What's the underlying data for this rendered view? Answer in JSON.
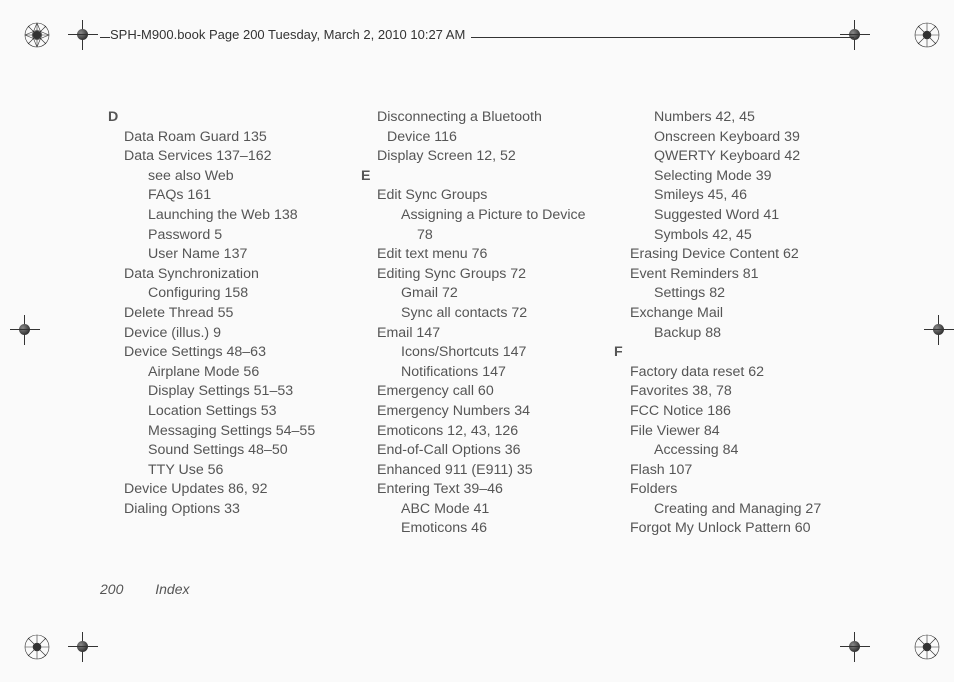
{
  "header": "SPH-M900.book  Page 200  Tuesday, March 2, 2010  10:27 AM",
  "footer": {
    "page": "200",
    "label": "Index"
  },
  "columns": [
    [
      {
        "cls": "letter",
        "t": "D"
      },
      {
        "cls": "l1",
        "t": "Data Roam Guard 135"
      },
      {
        "cls": "l1",
        "t": "Data Services 137–162"
      },
      {
        "cls": "l2",
        "t": "see also Web"
      },
      {
        "cls": "l2",
        "t": "FAQs 161"
      },
      {
        "cls": "l2",
        "t": "Launching the Web 138"
      },
      {
        "cls": "l2",
        "t": "Password 5"
      },
      {
        "cls": "l2",
        "t": "User Name 137"
      },
      {
        "cls": "l1",
        "t": "Data Synchronization"
      },
      {
        "cls": "l2",
        "t": "Configuring 158"
      },
      {
        "cls": "l1",
        "t": "Delete Thread 55"
      },
      {
        "cls": "l1",
        "t": "Device (illus.) 9"
      },
      {
        "cls": "l1",
        "t": "Device Settings 48–63"
      },
      {
        "cls": "l2",
        "t": "Airplane Mode 56"
      },
      {
        "cls": "l2",
        "t": "Display Settings 51–53"
      },
      {
        "cls": "l2",
        "t": "Location Settings 53"
      },
      {
        "cls": "l2",
        "t": "Messaging Settings 54–55"
      },
      {
        "cls": "l2",
        "t": "Sound Settings 48–50"
      },
      {
        "cls": "l2",
        "t": "TTY Use 56"
      },
      {
        "cls": "l1",
        "t": "Device Updates 86, 92"
      },
      {
        "cls": "l1",
        "t": "Dialing Options 33"
      }
    ],
    [
      {
        "cls": "hang",
        "t": "Disconnecting a Bluetooth"
      },
      {
        "cls": "hang-cont",
        "t": "Device 116"
      },
      {
        "cls": "l1",
        "t": "Display Screen 12, 52"
      },
      {
        "cls": "letter",
        "t": "E"
      },
      {
        "cls": "l1",
        "t": "Edit Sync Groups"
      },
      {
        "cls": "l2",
        "t": "Assigning a Picture to Device"
      },
      {
        "cls": "l3",
        "t": "78"
      },
      {
        "cls": "l1",
        "t": "Edit text menu 76"
      },
      {
        "cls": "l1",
        "t": "Editing Sync Groups 72"
      },
      {
        "cls": "l2",
        "t": "Gmail 72"
      },
      {
        "cls": "l2",
        "t": "Sync all contacts 72"
      },
      {
        "cls": "l1",
        "t": "Email 147"
      },
      {
        "cls": "l2",
        "t": "Icons/Shortcuts 147"
      },
      {
        "cls": "l2",
        "t": "Notifications 147"
      },
      {
        "cls": "l1",
        "t": "Emergency call 60"
      },
      {
        "cls": "l1",
        "t": "Emergency Numbers 34"
      },
      {
        "cls": "l1",
        "t": "Emoticons 12, 43, 126"
      },
      {
        "cls": "l1",
        "t": "End-of-Call Options 36"
      },
      {
        "cls": "l1",
        "t": "Enhanced 911 (E911) 35"
      },
      {
        "cls": "l1",
        "t": "Entering Text 39–46"
      },
      {
        "cls": "l2",
        "t": "ABC Mode 41"
      },
      {
        "cls": "l2",
        "t": "Emoticons 46"
      }
    ],
    [
      {
        "cls": "l2",
        "t": "Numbers 42, 45"
      },
      {
        "cls": "l2",
        "t": "Onscreen Keyboard 39"
      },
      {
        "cls": "l2",
        "t": "QWERTY Keyboard 42"
      },
      {
        "cls": "l2",
        "t": "Selecting Mode 39"
      },
      {
        "cls": "l2",
        "t": "Smileys 45, 46"
      },
      {
        "cls": "l2",
        "t": "Suggested Word 41"
      },
      {
        "cls": "l2",
        "t": "Symbols 42, 45"
      },
      {
        "cls": "l1",
        "t": "Erasing Device Content 62"
      },
      {
        "cls": "l1",
        "t": "Event Reminders 81"
      },
      {
        "cls": "l2",
        "t": "Settings 82"
      },
      {
        "cls": "l1",
        "t": "Exchange Mail"
      },
      {
        "cls": "l2",
        "t": "Backup 88"
      },
      {
        "cls": "letter",
        "t": "F"
      },
      {
        "cls": "l1",
        "t": "Factory data reset 62"
      },
      {
        "cls": "l1",
        "t": "Favorites 38, 78"
      },
      {
        "cls": "l1",
        "t": "FCC Notice 186"
      },
      {
        "cls": "l1",
        "t": "File Viewer 84"
      },
      {
        "cls": "l2",
        "t": "Accessing 84"
      },
      {
        "cls": "l1",
        "t": "Flash 107"
      },
      {
        "cls": "l1",
        "t": "Folders"
      },
      {
        "cls": "l2",
        "t": "Creating and Managing 27"
      },
      {
        "cls": "l1",
        "t": "Forgot My Unlock Pattern 60"
      }
    ]
  ]
}
